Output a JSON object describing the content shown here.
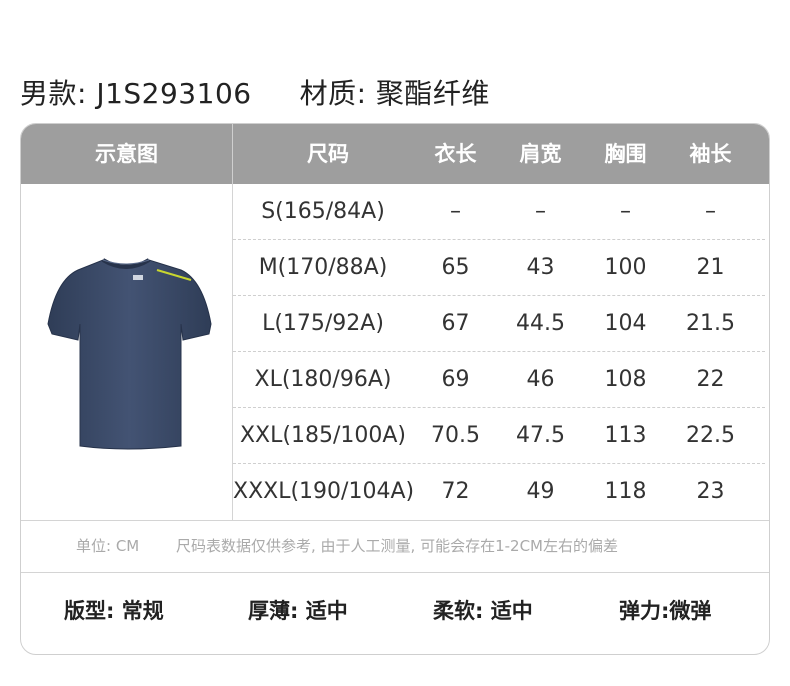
{
  "product": {
    "model_label": "男款: J1S293106",
    "material_label": "材质: 聚酯纤维"
  },
  "table": {
    "headers": [
      "示意图",
      "尺码",
      "衣长",
      "肩宽",
      "胸围",
      "袖长"
    ],
    "rows": [
      [
        "S(165/84A)",
        "–",
        "–",
        "–",
        "–"
      ],
      [
        "M(170/88A)",
        "65",
        "43",
        "100",
        "21"
      ],
      [
        "L(175/92A)",
        "67",
        "44.5",
        "104",
        "21.5"
      ],
      [
        "XL(180/96A)",
        "69",
        "46",
        "108",
        "22"
      ],
      [
        "XXL(185/100A)",
        "70.5",
        "47.5",
        "113",
        "22.5"
      ],
      [
        "XXXL(190/104A)",
        "72",
        "49",
        "118",
        "23"
      ]
    ]
  },
  "note": {
    "unit": "单位: CM",
    "text": "尺码表数据仅供参考, 由于人工测量, 可能会存在1-2CM左右的偏差"
  },
  "attributes": [
    "版型: 常规",
    "厚薄: 适中",
    "柔软: 适中",
    "弹力:微弹"
  ],
  "colors": {
    "header_bg": "#9e9e9e",
    "shirt": "#3a4a66",
    "shirt_accent": "#c8d62f"
  }
}
